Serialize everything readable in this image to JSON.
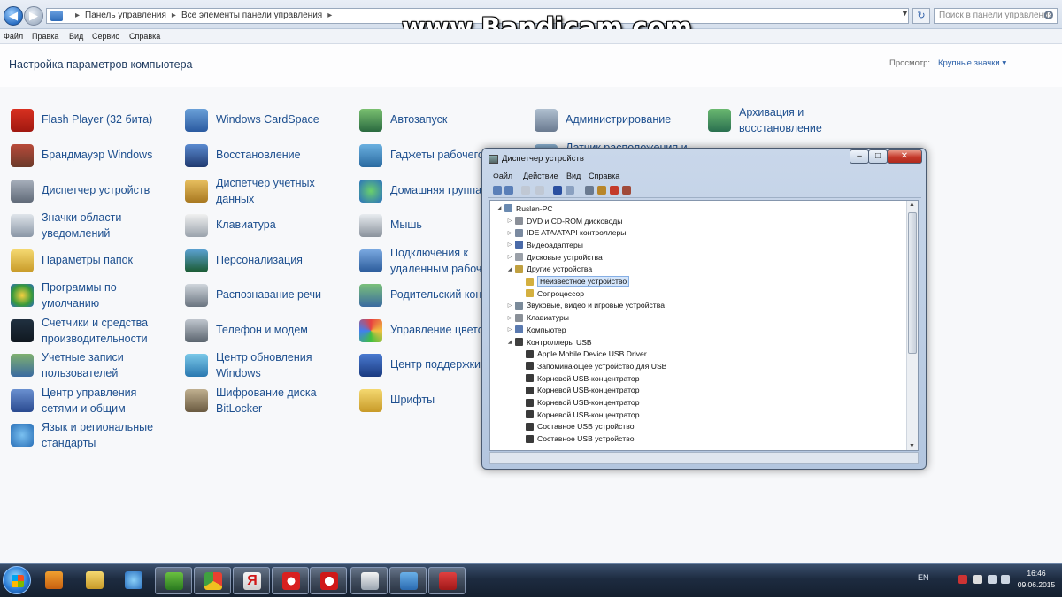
{
  "watermark": "www.Bandicam.com",
  "address_bar": {
    "crumbs": [
      "Панель управления",
      "Все элементы панели управления"
    ],
    "search_placeholder": "Поиск в панели управления"
  },
  "menubar": [
    "Файл",
    "Правка",
    "Вид",
    "Сервис",
    "Справка"
  ],
  "header": {
    "title": "Настройка параметров компьютера",
    "view_label": "Просмотр:",
    "view_value": "Крупные значки ▾"
  },
  "columns": [
    [
      {
        "label": "Flash Player (32 бита)",
        "icon": "flash-icon"
      },
      {
        "label": "Брандмауэр Windows",
        "icon": "firewall-icon"
      },
      {
        "label": "Диспетчер устройств",
        "icon": "device-manager-icon"
      },
      {
        "label": "Значки области\nуведомлений",
        "icon": "notification-icons-icon"
      },
      {
        "label": "Параметры папок",
        "icon": "folder-options-icon"
      },
      {
        "label": "Программы по\nумолчанию",
        "icon": "default-programs-icon"
      },
      {
        "label": "Счетчики и средства\nпроизводительности",
        "icon": "performance-icon"
      },
      {
        "label": "Учетные записи\nпользователей",
        "icon": "user-accounts-icon"
      },
      {
        "label": "Центр управления\nсетями и общим",
        "icon": "network-center-icon"
      },
      {
        "label": "Язык и региональные\nстандарты",
        "icon": "region-icon"
      }
    ],
    [
      {
        "label": "Windows CardSpace",
        "icon": "cardspace-icon"
      },
      {
        "label": "Восстановление",
        "icon": "recovery-icon"
      },
      {
        "label": "Диспетчер учетных\nданных",
        "icon": "credential-manager-icon"
      },
      {
        "label": "Клавиатура",
        "icon": "keyboard-icon"
      },
      {
        "label": "Персонализация",
        "icon": "personalization-icon"
      },
      {
        "label": "Распознавание речи",
        "icon": "speech-icon"
      },
      {
        "label": "Телефон и модем",
        "icon": "phone-modem-icon"
      },
      {
        "label": "Центр обновления\nWindows",
        "icon": "windows-update-icon"
      },
      {
        "label": "Шифрование диска\nBitLocker",
        "icon": "bitlocker-icon"
      }
    ],
    [
      {
        "label": "Автозапуск",
        "icon": "autoplay-icon"
      },
      {
        "label": "Гаджеты рабочего",
        "icon": "gadgets-icon"
      },
      {
        "label": "Домашняя группа",
        "icon": "homegroup-icon"
      },
      {
        "label": "Мышь",
        "icon": "mouse-icon"
      },
      {
        "label": "Подключения к\nудаленным рабочим",
        "icon": "remote-connections-icon"
      },
      {
        "label": "Родительский контроль",
        "icon": "parental-control-icon"
      },
      {
        "label": "Управление цветом",
        "icon": "color-management-icon"
      },
      {
        "label": "Центр поддержки",
        "icon": "action-center-icon"
      },
      {
        "label": "Шрифты",
        "icon": "fonts-icon"
      }
    ],
    [
      {
        "label": "Администрирование",
        "icon": "admin-tools-icon"
      },
      {
        "label": "Датчик расположения и\nдругие датчики",
        "icon": "location-sensor-icon"
      }
    ],
    [
      {
        "label": "Архивация и\nвосстановление",
        "icon": "backup-icon"
      }
    ]
  ],
  "device_manager": {
    "title": "Диспетчер устройств",
    "menu": [
      "Файл",
      "Действие",
      "Вид",
      "Справка"
    ],
    "tree": [
      {
        "label": "Ruslan-PC",
        "level": 0,
        "exp": "◢"
      },
      {
        "label": "DVD и CD-ROM дисководы",
        "level": 1,
        "exp": "▷"
      },
      {
        "label": "IDE ATA/ATAPI контроллеры",
        "level": 1,
        "exp": "▷"
      },
      {
        "label": "Видеоадаптеры",
        "level": 1,
        "exp": "▷"
      },
      {
        "label": "Дисковые устройства",
        "level": 1,
        "exp": "▷"
      },
      {
        "label": "Другие устройства",
        "level": 1,
        "exp": "◢"
      },
      {
        "label": "Неизвестное устройство",
        "level": 2,
        "exp": "",
        "selected": true
      },
      {
        "label": "Сопроцессор",
        "level": 2,
        "exp": ""
      },
      {
        "label": "Звуковые, видео и игровые устройства",
        "level": 1,
        "exp": "▷"
      },
      {
        "label": "Клавиатуры",
        "level": 1,
        "exp": "▷"
      },
      {
        "label": "Компьютер",
        "level": 1,
        "exp": "▷"
      },
      {
        "label": "Контроллеры USB",
        "level": 1,
        "exp": "◢"
      },
      {
        "label": "Apple Mobile Device USB Driver",
        "level": 2,
        "exp": ""
      },
      {
        "label": "Запоминающее устройство для USB",
        "level": 2,
        "exp": ""
      },
      {
        "label": "Корневой USB-концентратор",
        "level": 2,
        "exp": ""
      },
      {
        "label": "Корневой USB-концентратор",
        "level": 2,
        "exp": ""
      },
      {
        "label": "Корневой USB-концентратор",
        "level": 2,
        "exp": ""
      },
      {
        "label": "Корневой USB-концентратор",
        "level": 2,
        "exp": ""
      },
      {
        "label": "Составное USB устройство",
        "level": 2,
        "exp": ""
      },
      {
        "label": "Составное USB устройство",
        "level": 2,
        "exp": ""
      }
    ]
  },
  "taskbar": {
    "apps": [
      "media-player-icon",
      "explorer-icon",
      "internet-explorer-icon",
      "utorrent-icon",
      "chrome-icon",
      "yandex-icon",
      "yandex-browser-icon",
      "opera-icon",
      "notepad-icon",
      "control-panel-icon",
      "bandicam-icon"
    ],
    "lang": "EN",
    "time": "16:46",
    "date": "09.06.2015"
  }
}
